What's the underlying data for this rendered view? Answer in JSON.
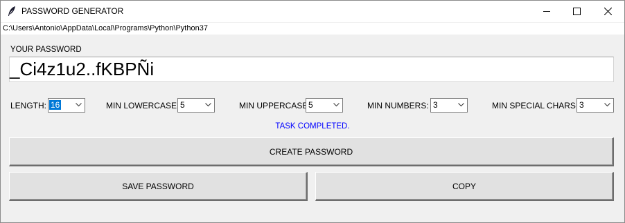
{
  "window": {
    "title": "PASSWORD GENERATOR",
    "icon": "feather-icon"
  },
  "path": "C:\\Users\\Antonio\\AppData\\Local\\Programs\\Python\\Python37",
  "password": {
    "label": "YOUR PASSWORD",
    "value": "_Ci4z1u2..fKBPÑi"
  },
  "options": {
    "length": {
      "label": "LENGTH:",
      "value": "16"
    },
    "min_lowercase": {
      "label": "MIN LOWERCASE:",
      "value": "5"
    },
    "min_uppercase": {
      "label": "MIN UPPERCASE:",
      "value": "5"
    },
    "min_numbers": {
      "label": "MIN NUMBERS:",
      "value": "3"
    },
    "min_special": {
      "label": "MIN SPECIAL CHARS:",
      "value": "3"
    }
  },
  "status": {
    "text": "TASK COMPLETED.",
    "color": "#0000ff"
  },
  "buttons": {
    "create": "CREATE PASSWORD",
    "save": "SAVE PASSWORD",
    "copy": "COPY"
  },
  "colors": {
    "focus_highlight": "#0078d7",
    "window_bg": "#f0f0f0",
    "button_bg": "#e1e1e1"
  }
}
